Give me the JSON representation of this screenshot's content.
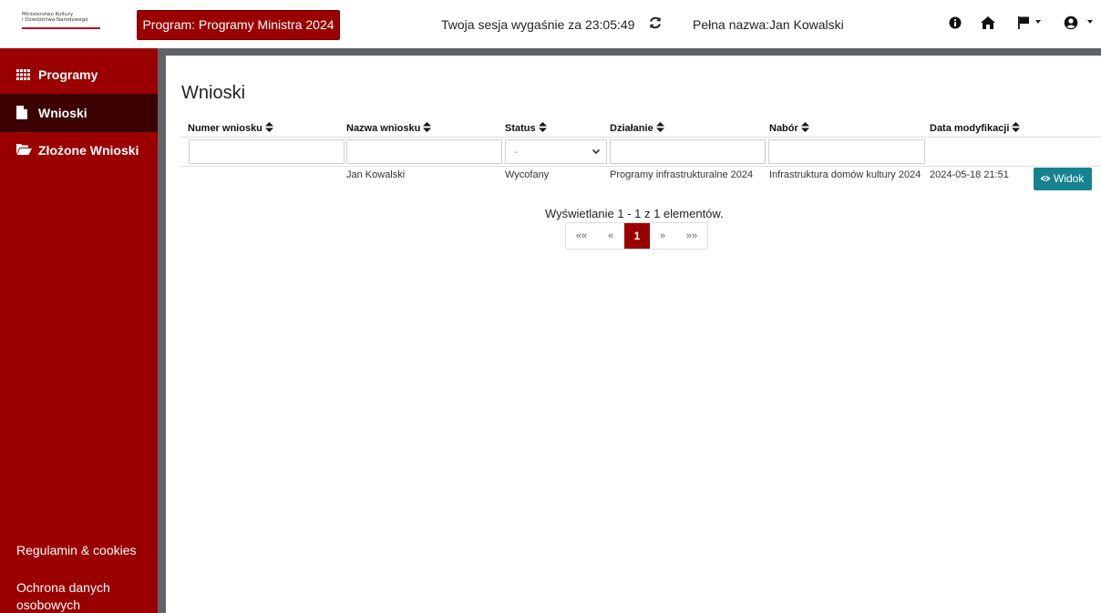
{
  "header": {
    "logo_line1": "Ministerstwo Kultury",
    "logo_line2": "i Dziedzictwa Narodowego",
    "program_label": "Program: Programy Ministra 2024",
    "session_text": "Twoja sesja wygaśnie za 23:05:49",
    "fullname_text": "Pełna nazwa:Jan Kowalski"
  },
  "sidebar": {
    "items": [
      {
        "label": "Programy",
        "icon": "grid-icon"
      },
      {
        "label": "Wnioski",
        "icon": "file-icon",
        "active": true
      },
      {
        "label": "Złożone Wnioski",
        "icon": "folder-open-icon"
      }
    ],
    "footer": {
      "terms": "Regulamin & cookies",
      "privacy_line1": "Ochrona danych",
      "privacy_line2": "osobowych"
    }
  },
  "main": {
    "title": "Wnioski",
    "columns": [
      "Numer wniosku",
      "Nazwa wniosku",
      "Status",
      "Działanie",
      "Nabór",
      "Data modyfikacji"
    ],
    "filters": {
      "status_selected": "-"
    },
    "rows": [
      {
        "numer": "",
        "nazwa": "Jan Kowalski",
        "status": "Wycofany",
        "dzialanie": "Programy infrastrukturalne 2024",
        "nabor": "Infrastruktura domów kultury 2024",
        "data": "2024-05-18 21:51",
        "action": "Widok"
      }
    ],
    "summary": "Wyświetlanie 1 - 1 z 1 elementów.",
    "pagination": {
      "first": "««",
      "prev": "«",
      "current": "1",
      "next": "»",
      "last": "»»"
    }
  },
  "colors": {
    "brand_red": "#9b0000",
    "sidebar_active": "#3b0000",
    "view_button": "#15838f"
  }
}
